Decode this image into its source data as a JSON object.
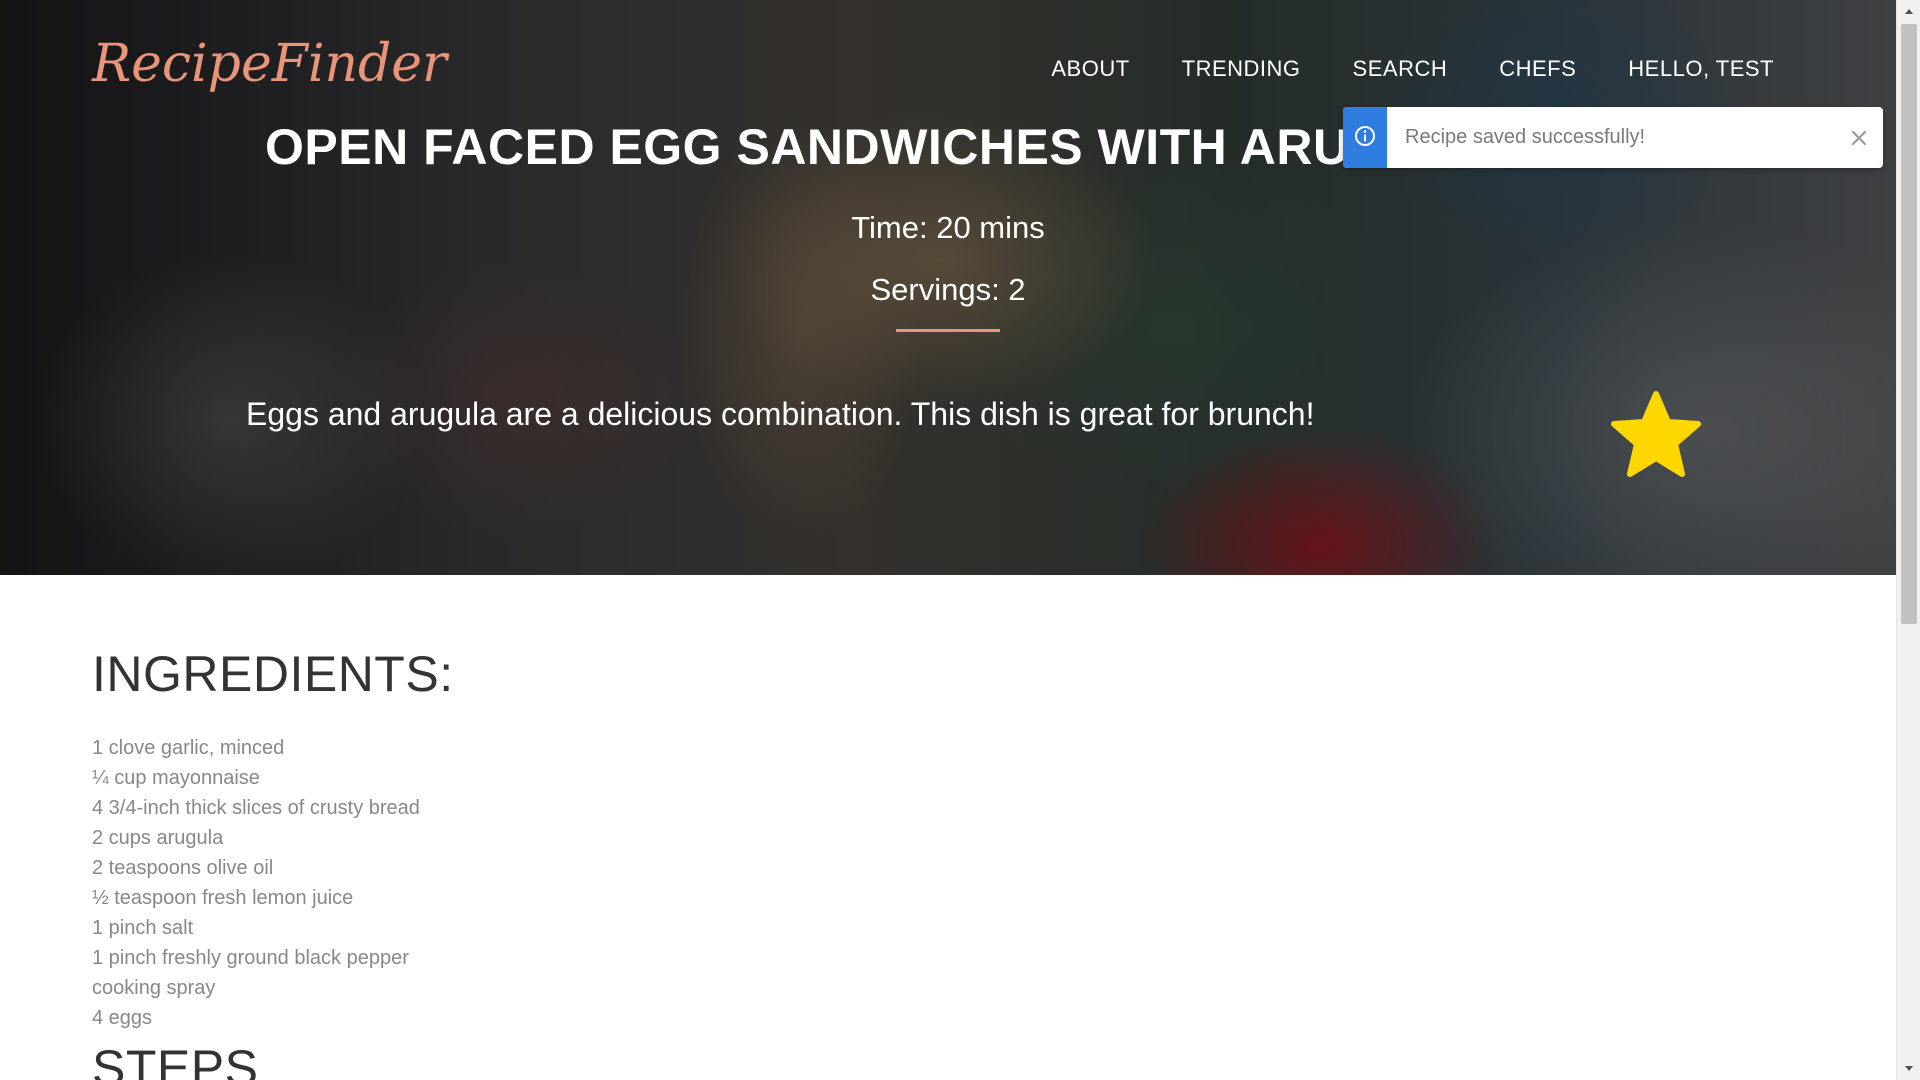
{
  "brand": {
    "name": "RecipeFinder"
  },
  "nav": {
    "items": [
      {
        "label": "ABOUT"
      },
      {
        "label": "TRENDING"
      },
      {
        "label": "SEARCH"
      },
      {
        "label": "CHEFS"
      },
      {
        "label": "HELLO, TEST"
      }
    ]
  },
  "recipe": {
    "title": "OPEN FACED EGG SANDWICHES WITH ARUGULA",
    "time": "Time: 20 mins",
    "servings": "Servings: 2",
    "description": "Eggs and arugula are a delicious combination. This dish is great for brunch!",
    "favorite_icon": "star-icon",
    "favorite_color": "#ffd700"
  },
  "toast": {
    "message": "Recipe saved successfully!",
    "icon": "info-icon",
    "accent_color": "#2f7de1"
  },
  "ingredients": {
    "heading": "INGREDIENTS:",
    "items": [
      "1 clove garlic, minced",
      "¼ cup mayonnaise",
      "4 3/4-inch thick slices of crusty bread",
      "2 cups arugula",
      "2 teaspoons olive oil",
      "½ teaspoon fresh lemon juice",
      "1 pinch salt",
      "1 pinch freshly ground black pepper",
      "cooking spray",
      "4 eggs"
    ]
  },
  "steps": {
    "heading": "STEPS"
  },
  "colors": {
    "accent": "#e8957a",
    "heading_text": "#333333",
    "ingredient_text": "#888888"
  }
}
